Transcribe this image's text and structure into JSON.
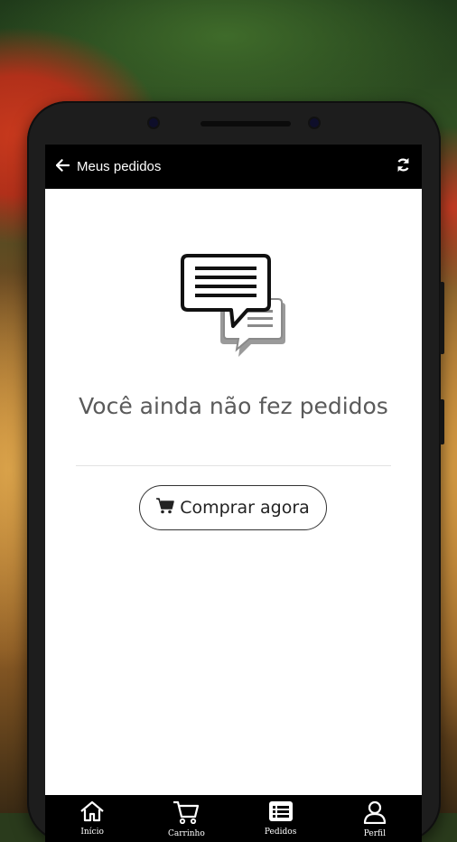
{
  "header": {
    "back_icon": "arrow-left-icon",
    "title": "Meus pedidos",
    "refresh_icon": "refresh-icon"
  },
  "empty_state": {
    "illustration": "chat-bubbles-icon",
    "message": "Você ainda não fez pedidos",
    "button_label": "Comprar agora",
    "button_icon": "cart-icon"
  },
  "bottom_nav": {
    "items": [
      {
        "label": "Início",
        "icon": "home-icon"
      },
      {
        "label": "Carrinho",
        "icon": "cart-icon"
      },
      {
        "label": "Pedidos",
        "icon": "list-icon"
      },
      {
        "label": "Perfil",
        "icon": "user-icon"
      }
    ]
  },
  "colors": {
    "topbar": "#000000",
    "screen": "#ffffff",
    "text_muted": "#5a5a5a"
  }
}
